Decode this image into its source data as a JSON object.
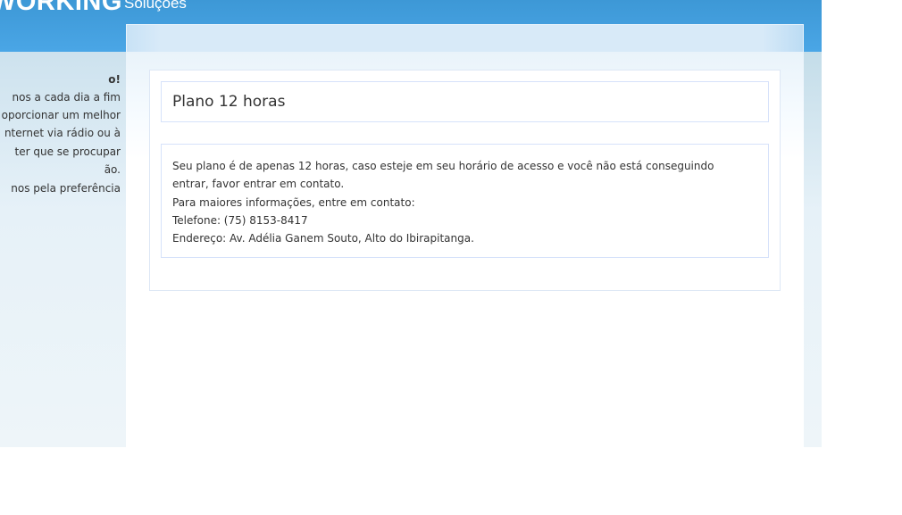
{
  "header": {
    "logo": "WORKING",
    "tagline": "Soluções"
  },
  "sidebar": {
    "lines": [
      "o!",
      "nos a cada dia a fim",
      "oporcionar um melhor",
      "nternet via rádio ou à",
      "ter que se procupar",
      "ão.",
      "nos pela preferência"
    ]
  },
  "main": {
    "title": "Plano 12 horas",
    "body": [
      "Seu plano é de apenas 12 horas, caso esteje em seu horário de acesso e você não está conseguindo",
      "entrar, favor entrar em contato.",
      "Para maiores informações, entre em contato:",
      "Telefone: (75) 8153-8417",
      "Endereço: Av. Adélia Ganem Souto, Alto do Ibirapitanga."
    ]
  }
}
